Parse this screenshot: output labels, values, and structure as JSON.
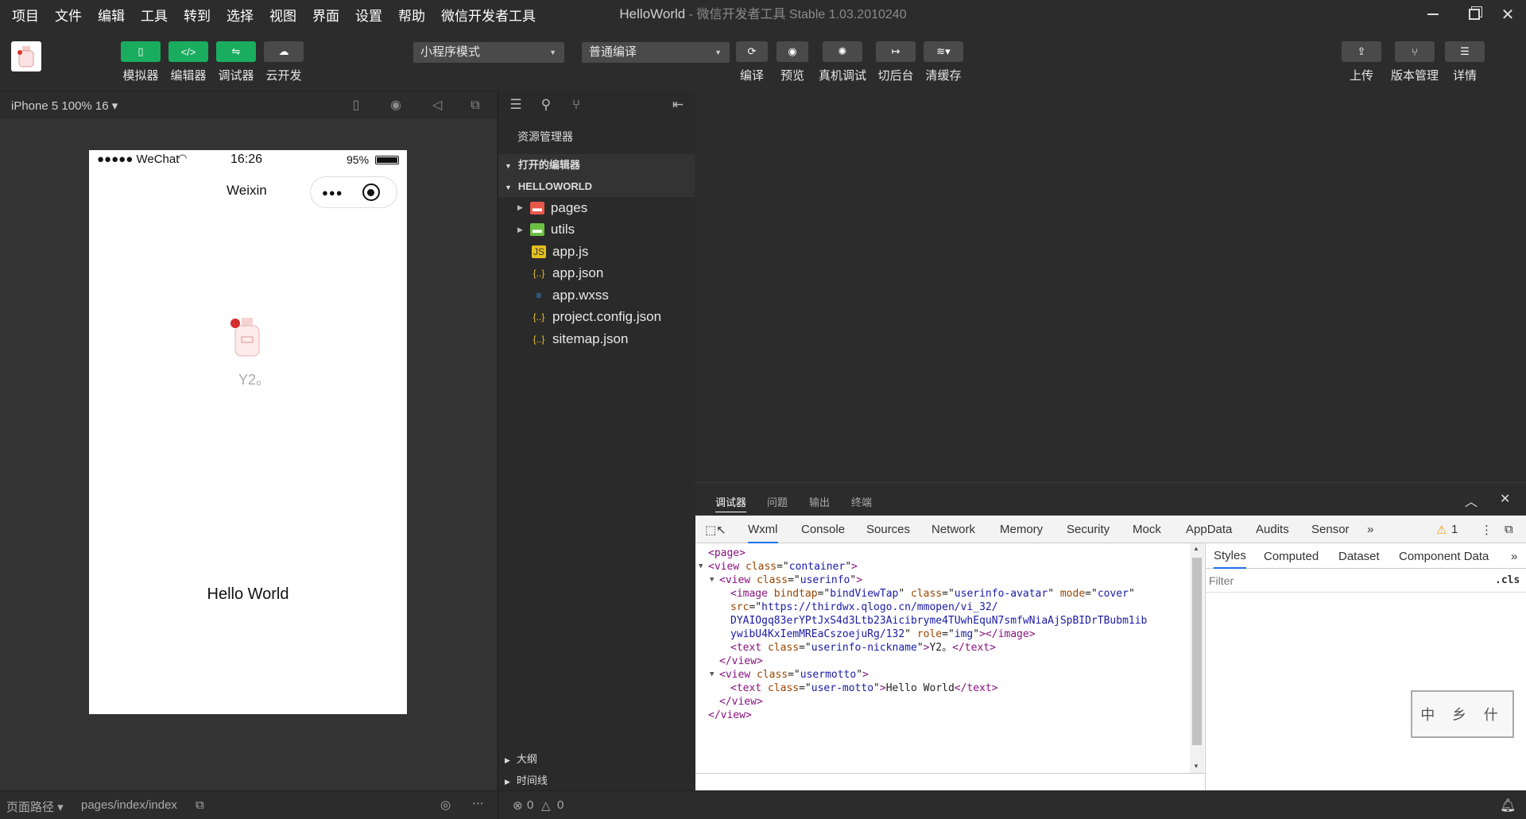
{
  "menubar": {
    "items": [
      "项目",
      "文件",
      "编辑",
      "工具",
      "转到",
      "选择",
      "视图",
      "界面",
      "设置",
      "帮助",
      "微信开发者工具"
    ]
  },
  "window": {
    "project": "HelloWorld",
    "suffix": " - 微信开发者工具 Stable 1.03.2010240"
  },
  "toolbar": {
    "left_buttons": [
      {
        "label": "模拟器"
      },
      {
        "label": "编辑器"
      },
      {
        "label": "调试器"
      },
      {
        "label": "云开发"
      }
    ],
    "mode_select": "小程序模式",
    "compile_select": "普通编译",
    "mid_buttons": [
      {
        "label": "编译"
      },
      {
        "label": "预览"
      },
      {
        "label": "真机调试"
      },
      {
        "label": "切后台"
      },
      {
        "label": "清缓存"
      }
    ],
    "right_buttons": [
      {
        "label": "上传"
      },
      {
        "label": "版本管理"
      },
      {
        "label": "详情"
      }
    ]
  },
  "simulator": {
    "device": "iPhone 5 100% 16 ▾",
    "carrier": "●●●●● WeChat",
    "time": "16:26",
    "battery": "95%",
    "nav_title": "Weixin",
    "nickname": "Y2。",
    "motto": "Hello World"
  },
  "bottom_left": {
    "path_label": "页面路径 ▾",
    "path": "pages/index/index"
  },
  "explorer": {
    "title": "资源管理器",
    "open_editors": "打开的编辑器",
    "project": "HELLOWORLD",
    "files": [
      {
        "name": "pages",
        "kind": "folder-red"
      },
      {
        "name": "utils",
        "kind": "folder-green"
      },
      {
        "name": "app.js",
        "kind": "js"
      },
      {
        "name": "app.json",
        "kind": "json"
      },
      {
        "name": "app.wxss",
        "kind": "css"
      },
      {
        "name": "project.config.json",
        "kind": "json"
      },
      {
        "name": "sitemap.json",
        "kind": "json"
      }
    ],
    "outline": "大纲",
    "timeline": "时间线",
    "errors": "0",
    "warnings": "0"
  },
  "debugger": {
    "panel_tabs": [
      "调试器",
      "问题",
      "输出",
      "终端"
    ],
    "tabs": [
      "Wxml",
      "Console",
      "Sources",
      "Network",
      "Memory",
      "Security",
      "Mock",
      "AppData",
      "Audits",
      "Sensor"
    ],
    "warn_count": "1",
    "styles_tabs": [
      "Styles",
      "Computed",
      "Dataset",
      "Component Data"
    ],
    "filter_placeholder": "Filter",
    "cls": ".cls",
    "seal_text": "中 乡 什"
  },
  "wxml": [
    {
      "indent": 0,
      "arrow": "",
      "html": "<span class='tg'>&lt;page&gt;</span>"
    },
    {
      "indent": 0,
      "arrow": "▼",
      "html": "<span class='tg'>&lt;view</span> <span class='an'>class</span>=\"<span class='av'>container</span>\"<span class='tg'>&gt;</span>"
    },
    {
      "indent": 1,
      "arrow": "▼",
      "html": "<span class='tg'>&lt;view</span> <span class='an'>class</span>=\"<span class='av'>userinfo</span>\"<span class='tg'>&gt;</span>"
    },
    {
      "indent": 2,
      "arrow": "",
      "html": "<span class='tg'>&lt;image</span> <span class='an'>bindtap</span>=\"<span class='av'>bindViewTap</span>\" <span class='an'>class</span>=\"<span class='av'>userinfo-avatar</span>\" <span class='an'>mode</span>=\"<span class='av'>cover</span>\""
    },
    {
      "indent": 2,
      "arrow": "",
      "html": "<span class='an'>src</span>=\"<span class='av'>https://thirdwx.qlogo.cn/mmopen/vi_32/</span>"
    },
    {
      "indent": 2,
      "arrow": "",
      "html": "<span class='av'>DYAIOgq83erYPtJxS4d3Ltb23Aicibryme4TUwhEquN7smfwNiaAjSpBIDrTBubm1ib</span>"
    },
    {
      "indent": 2,
      "arrow": "",
      "html": "<span class='av'>ywibU4KxIemMREaCszoejuRg/132</span>\" <span class='an'>role</span>=\"<span class='av'>img</span>\"<span class='tg'>&gt;&lt;/image&gt;</span>"
    },
    {
      "indent": 2,
      "arrow": "",
      "html": "<span class='tg'>&lt;text</span> <span class='an'>class</span>=\"<span class='av'>userinfo-nickname</span>\"<span class='tg'>&gt;</span>Y2。<span class='tg'>&lt;/text&gt;</span>"
    },
    {
      "indent": 1,
      "arrow": "",
      "html": "<span class='tg'>&lt;/view&gt;</span>"
    },
    {
      "indent": 1,
      "arrow": "▼",
      "html": "<span class='tg'>&lt;view</span> <span class='an'>class</span>=\"<span class='av'>usermotto</span>\"<span class='tg'>&gt;</span>"
    },
    {
      "indent": 2,
      "arrow": "",
      "html": "<span class='tg'>&lt;text</span> <span class='an'>class</span>=\"<span class='av'>user-motto</span>\"<span class='tg'>&gt;</span>Hello World<span class='tg'>&lt;/text&gt;</span>"
    },
    {
      "indent": 1,
      "arrow": "",
      "html": "<span class='tg'>&lt;/view&gt;</span>"
    },
    {
      "indent": 0,
      "arrow": "",
      "html": "<span class='tg'>&lt;/view&gt;</span>"
    }
  ]
}
